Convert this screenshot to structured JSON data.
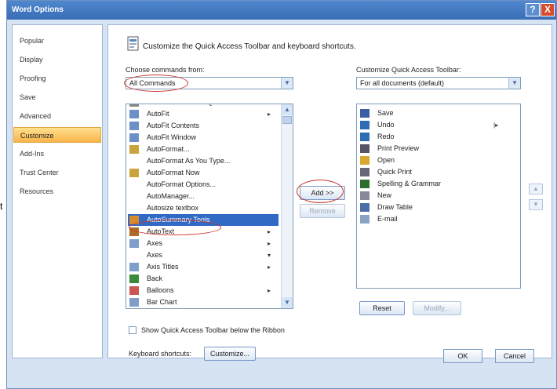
{
  "stray_char": "t",
  "window": {
    "title": "Word Options",
    "help_label": "?",
    "close_label": "X"
  },
  "nav": {
    "items": [
      "Popular",
      "Display",
      "Proofing",
      "Save",
      "Advanced",
      "Customize",
      "Add-Ins",
      "Trust Center",
      "Resources"
    ],
    "selected_index": 5
  },
  "content": {
    "heading": "Customize the Quick Access Toolbar and keyboard shortcuts.",
    "choose_label": "Choose commands from:",
    "choose_value": "All Commands",
    "customize_label": "Customize Quick Access Toolbar:",
    "customize_value": "For all documents (default)",
    "commands": [
      {
        "label": "AutoCorrect Smart Quotes",
        "icon": "autocorrect-icon",
        "submenu": ""
      },
      {
        "label": "AutoFit",
        "icon": "table-icon",
        "submenu": "▸"
      },
      {
        "label": "AutoFit Contents",
        "icon": "table-icon",
        "submenu": ""
      },
      {
        "label": "AutoFit Window",
        "icon": "table-icon",
        "submenu": ""
      },
      {
        "label": "AutoFormat...",
        "icon": "document-icon",
        "submenu": ""
      },
      {
        "label": "AutoFormat As You Type...",
        "icon": "",
        "submenu": ""
      },
      {
        "label": "AutoFormat Now",
        "icon": "document-icon",
        "submenu": ""
      },
      {
        "label": "AutoFormat Options...",
        "icon": "",
        "submenu": ""
      },
      {
        "label": "AutoManager...",
        "icon": "",
        "submenu": ""
      },
      {
        "label": "Autosize textbox",
        "icon": "",
        "submenu": ""
      },
      {
        "label": "AutoSummary Tools",
        "icon": "summary-icon",
        "submenu": ""
      },
      {
        "label": "AutoText",
        "icon": "autotext-icon",
        "submenu": "▸"
      },
      {
        "label": "Axes",
        "icon": "chart-icon",
        "submenu": "▸"
      },
      {
        "label": "Axes",
        "icon": "",
        "submenu": "▾"
      },
      {
        "label": "Axis Titles",
        "icon": "chart-icon",
        "submenu": "▸"
      },
      {
        "label": "Back",
        "icon": "back-icon",
        "submenu": ""
      },
      {
        "label": "Balloons",
        "icon": "balloon-icon",
        "submenu": "▸"
      },
      {
        "label": "Bar Chart",
        "icon": "chart-icon",
        "submenu": ""
      }
    ],
    "selected_command": 10,
    "toolbar_items": [
      {
        "label": "Save",
        "icon": "save-icon",
        "submenu": ""
      },
      {
        "label": "Undo",
        "icon": "undo-icon",
        "submenu": "|▸"
      },
      {
        "label": "Redo",
        "icon": "redo-icon",
        "submenu": ""
      },
      {
        "label": "Print Preview",
        "icon": "print-preview-icon",
        "submenu": ""
      },
      {
        "label": "Open",
        "icon": "open-folder-icon",
        "submenu": ""
      },
      {
        "label": "Quick Print",
        "icon": "printer-icon",
        "submenu": ""
      },
      {
        "label": "Spelling & Grammar",
        "icon": "spelling-icon",
        "submenu": ""
      },
      {
        "label": "New",
        "icon": "new-document-icon",
        "submenu": ""
      },
      {
        "label": "Draw Table",
        "icon": "draw-table-icon",
        "submenu": ""
      },
      {
        "label": "E-mail",
        "icon": "email-icon",
        "submenu": ""
      }
    ],
    "add_label": "Add >>",
    "remove_label": "Remove",
    "reset_label": "Reset",
    "modify_label": "Modify...",
    "show_below_label": "Show Quick Access Toolbar below the Ribbon",
    "keyboard_label": "Keyboard shortcuts:",
    "customize_button": "Customize...",
    "move_up": "▲",
    "move_down": "▼"
  },
  "footer": {
    "ok": "OK",
    "cancel": "Cancel"
  }
}
